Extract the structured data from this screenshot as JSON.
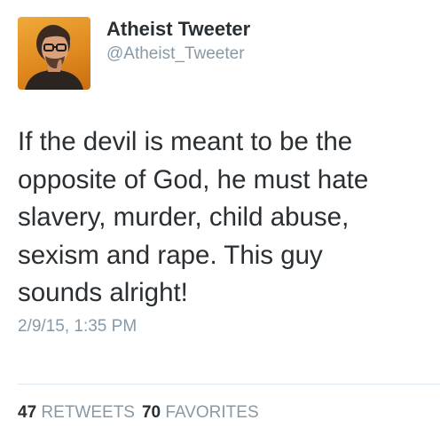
{
  "user": {
    "display_name": "Atheist Tweeter",
    "screen_name": "@Atheist_Tweeter"
  },
  "tweet": {
    "lines": [
      "If the devil is meant to be the",
      "opposite of God, he must hate",
      "slavery, murder, child abuse,",
      "sexism and rape. This guy",
      "sounds alright!"
    ],
    "timestamp": "2/9/15, 1:35 PM"
  },
  "stats": {
    "retweets_count": "47",
    "retweets_label": "RETWEETS",
    "favorites_count": "70",
    "favorites_label": "FAVORITES"
  },
  "colors": {
    "primary_text": "#292f33",
    "secondary_text": "#8899a6",
    "divider": "#e1e8ed",
    "avatar_background": "#e99a2c"
  },
  "icons": {
    "avatar": "profile-photo-avatar"
  }
}
